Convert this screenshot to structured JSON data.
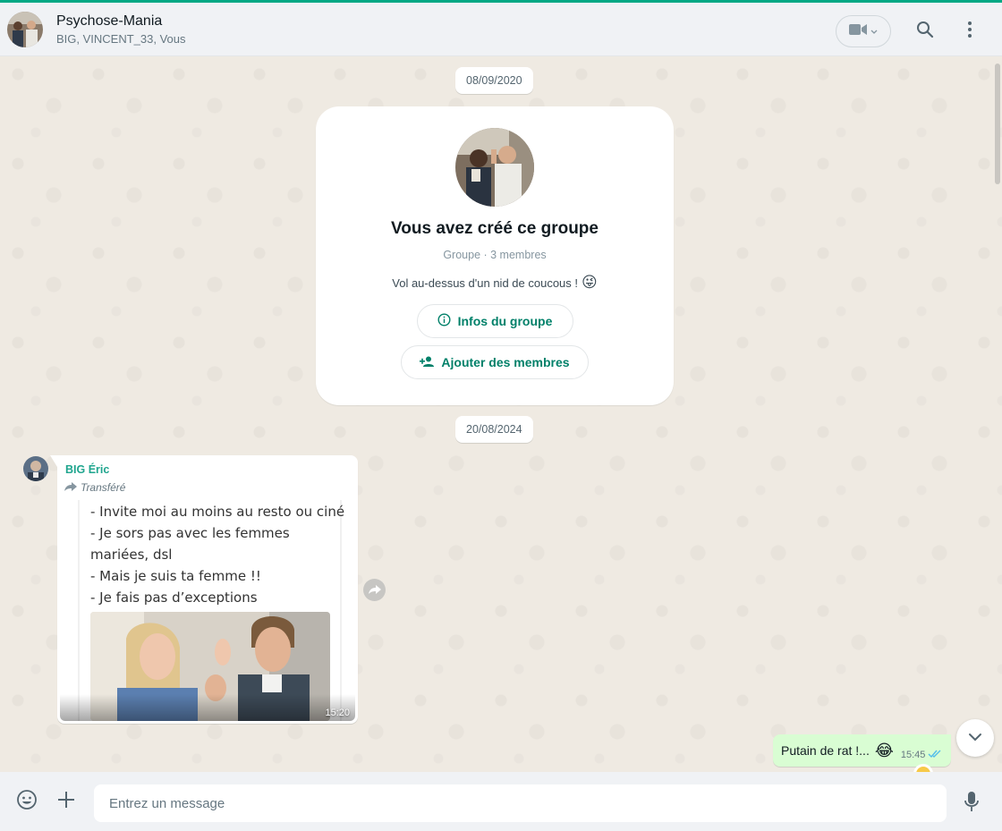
{
  "colors": {
    "accent": "#00a884",
    "outgoing_bubble": "#d9fdd3",
    "chat_bg": "#efeae2",
    "sender_name": "#1fa58e",
    "button_text": "#008069"
  },
  "header": {
    "title": "Psychose-Mania",
    "members": "BIG, VINCENT_33, Vous",
    "icons": [
      "video-icon",
      "search-icon",
      "menu-icon"
    ]
  },
  "chat": {
    "date_1": "08/09/2020",
    "group_card": {
      "title": "Vous avez créé ce groupe",
      "subtitle": "Groupe · 3 membres",
      "description": "Vol au-dessus d'un nid de coucous !",
      "description_emoji": "😜",
      "info_button": "Infos du groupe",
      "add_button": "Ajouter des membres"
    },
    "date_2": "20/08/2024",
    "incoming": {
      "sender": "BIG Éric",
      "forwarded_label": "Transféré",
      "meme_lines": [
        "- Invite moi au moins au resto ou ciné",
        "- Je sors pas avec les femmes",
        "mariées, dsl",
        "- Mais je suis ta femme !!",
        "- Je fais pas d’exceptions"
      ],
      "time": "15:20"
    },
    "outgoing": {
      "text": "Putain de rat !...",
      "emoji": "😂",
      "time": "15:45",
      "status": "read"
    }
  },
  "footer": {
    "placeholder": "Entrez un message",
    "icons": [
      "emoji-icon",
      "plus-icon",
      "mic-icon"
    ]
  }
}
